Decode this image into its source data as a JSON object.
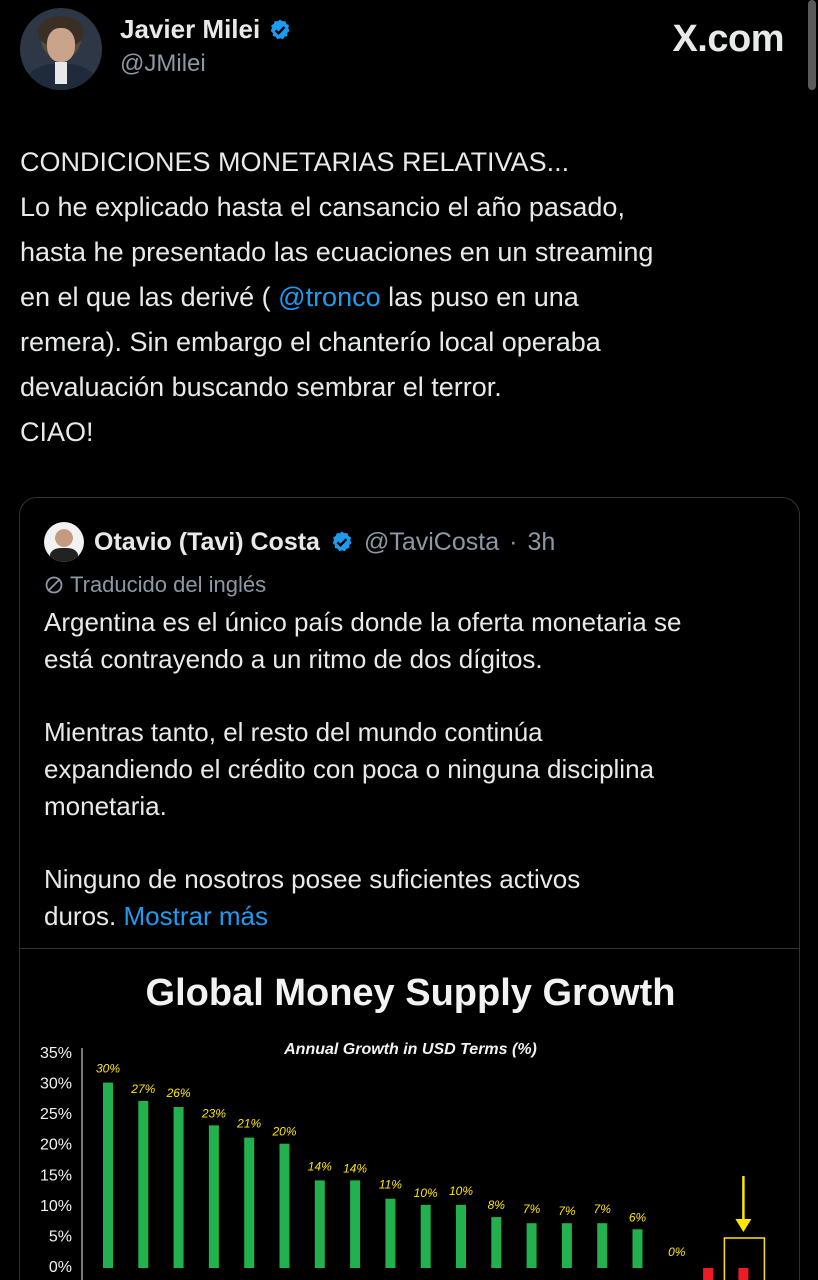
{
  "header": {
    "author_name": "Javier Milei",
    "author_handle": "@JMilei",
    "brand": "X.com"
  },
  "tweet": {
    "lines": [
      "CONDICIONES MONETARIAS RELATIVAS...",
      "Lo he explicado hasta el cansancio el año pasado,",
      "hasta he presentado las ecuaciones en un streaming",
      "en el que las derivé ( ",
      "@tronco",
      " las puso en una",
      "remera). Sin embargo el chanterío local operaba",
      "devaluación buscando sembrar el terror.",
      "CIAO!"
    ]
  },
  "quote": {
    "author_name": "Otavio (Tavi) Costa",
    "author_handle": "@TaviCosta",
    "separator": "·",
    "time": "3h",
    "translated_label": "Traducido del inglés",
    "text_lines": [
      "Argentina es el único país donde la oferta monetaria se",
      "está contrayendo a un ritmo de dos dígitos.",
      "Mientras tanto, el resto del mundo continúa",
      "expandiendo el crédito con poca o ninguna disciplina",
      "monetaria.",
      "Ninguno de nosotros posee suficientes activos",
      "duros. "
    ],
    "show_more": "Mostrar más"
  },
  "colors": {
    "link": "#1d9bf0",
    "verified": "#1d9bf0",
    "bar_positive": "#22b14c",
    "bar_negative": "#ed1c24",
    "highlight": "#ffe600"
  },
  "chart_data": {
    "type": "bar",
    "title": "Global Money Supply Growth",
    "subtitle": "Annual Growth in USD Terms (%)",
    "y_ticks": [
      "35%",
      "30%",
      "25%",
      "20%",
      "15%",
      "10%",
      "5%",
      "0%"
    ],
    "ylim": [
      0,
      35
    ],
    "values": [
      30,
      27,
      26,
      23,
      21,
      20,
      14,
      14,
      11,
      10,
      10,
      8,
      7,
      7,
      7,
      6,
      0,
      -2,
      -2
    ],
    "value_labels": [
      "30%",
      "27%",
      "26%",
      "23%",
      "21%",
      "20%",
      "14%",
      "14%",
      "11%",
      "10%",
      "10%",
      "8%",
      "7%",
      "7%",
      "7%",
      "6%",
      "0%",
      "",
      ""
    ],
    "highlighted_index": 18,
    "grid": false
  }
}
